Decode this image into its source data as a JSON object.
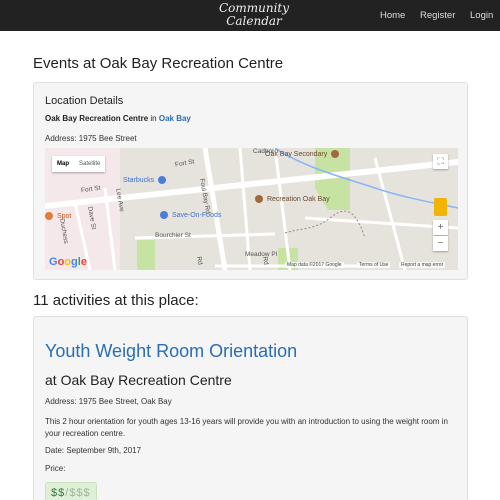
{
  "navbar": {
    "brand_line1": "Community",
    "brand_line2": "Calendar",
    "links": [
      "Home",
      "Register",
      "Login"
    ]
  },
  "page": {
    "heading": "Events at Oak Bay Recreation Centre"
  },
  "location": {
    "title": "Location Details",
    "name": "Oak Bay Recreation Centre",
    "in_word": "in",
    "city": "Oak Bay",
    "address": "Address: 1975 Bee Street"
  },
  "map": {
    "type_map": "Map",
    "type_satellite": "Satellite",
    "streets": [
      "Fort St",
      "Fort St",
      "Cadboro",
      "Foul Bay Rd",
      "Dave St",
      "Lee Ave",
      "Duchess",
      "Bourchier St",
      "Meadow Pl",
      "Rd",
      "Rd"
    ],
    "pois": [
      "Starbucks",
      "Save-On-Foods",
      "Recreation Oak Bay",
      "Oak Bay Secondary",
      "Spot"
    ],
    "footer": [
      "Map data ©2017 Google",
      "Terms of Use",
      "Report a map error"
    ],
    "logo": [
      "G",
      "o",
      "o",
      "g",
      "l",
      "e"
    ],
    "zoom_in": "+",
    "zoom_out": "−",
    "fullscreen": "⛶"
  },
  "activities": {
    "heading": "11 activities at this place:",
    "items": [
      {
        "title": "Youth Weight Room Orientation",
        "place": "at Oak Bay Recreation Centre",
        "address": "Address: 1975 Bee Street, Oak Bay",
        "description": "This 2 hour orientation for youth ages 13-16 years will provide you with an introduction to using the weight room in your recreation centre.",
        "date": "Date: September 9th, 2017",
        "price_label": "Price:",
        "price_on": "$$",
        "price_sep": "/",
        "price_off": "$$$",
        "price_level": 2,
        "price_max": 5
      }
    ]
  },
  "colors": {
    "navbar": "#222222",
    "link": "#2a6db3",
    "price_badge": "#dff0d8",
    "price_active": "#3c763d"
  }
}
